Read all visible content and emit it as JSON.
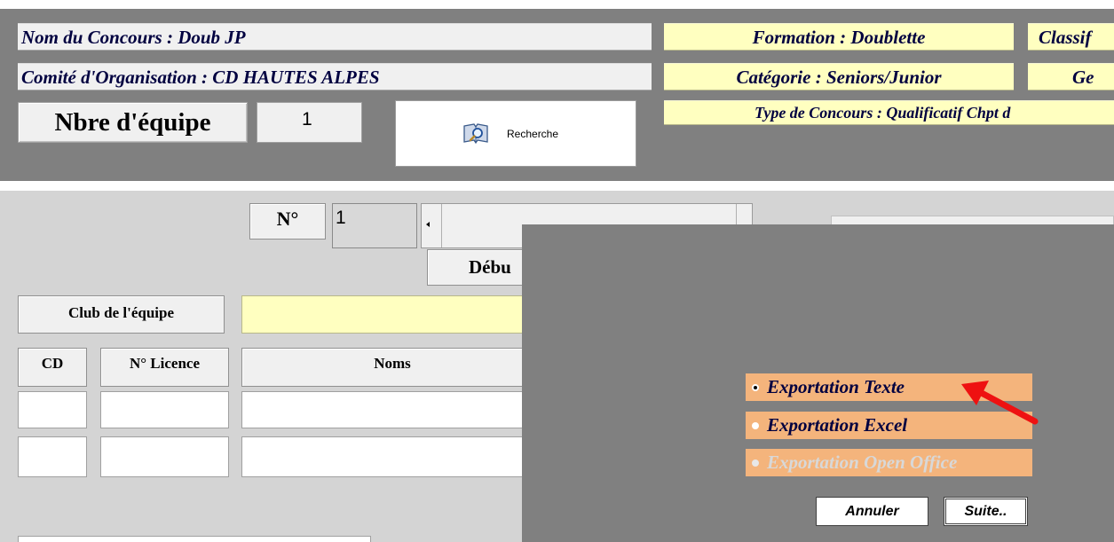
{
  "header": {
    "concours_name": "Nom du Concours : Doub  JP",
    "comite": "Comité d'Organisation : CD HAUTES ALPES",
    "formation": "Formation : Doublette",
    "classification": "Classif",
    "categorie": "Catégorie : Seniors/Junior",
    "genre": "Ge",
    "type_concours": "Type de Concours : Qualificatif Chpt d",
    "nb_equipe_label": "Nbre d'équipe",
    "nb_equipe_value": "1",
    "search_label": "Recherche",
    "search_icon": "search-book-icon"
  },
  "form": {
    "numero_label": "N°",
    "numero_value": "1",
    "debut_label": "Débu",
    "club_label": "Club de l'équipe",
    "col_cd": "CD",
    "col_licence": "N° Licence",
    "col_noms": "Noms"
  },
  "dialog": {
    "options": [
      {
        "label": "Exportation Texte",
        "selected": true,
        "enabled": true
      },
      {
        "label": "Exportation Excel",
        "selected": false,
        "enabled": true
      },
      {
        "label": "Exportation Open Office",
        "selected": false,
        "enabled": false
      }
    ],
    "cancel_label": "Annuler",
    "next_label": "Suite..",
    "arrow_color": "#ee1111"
  },
  "colors": {
    "header_bg": "#808080",
    "field_yellow": "#ffffc0",
    "option_bg": "#f4b47c"
  }
}
